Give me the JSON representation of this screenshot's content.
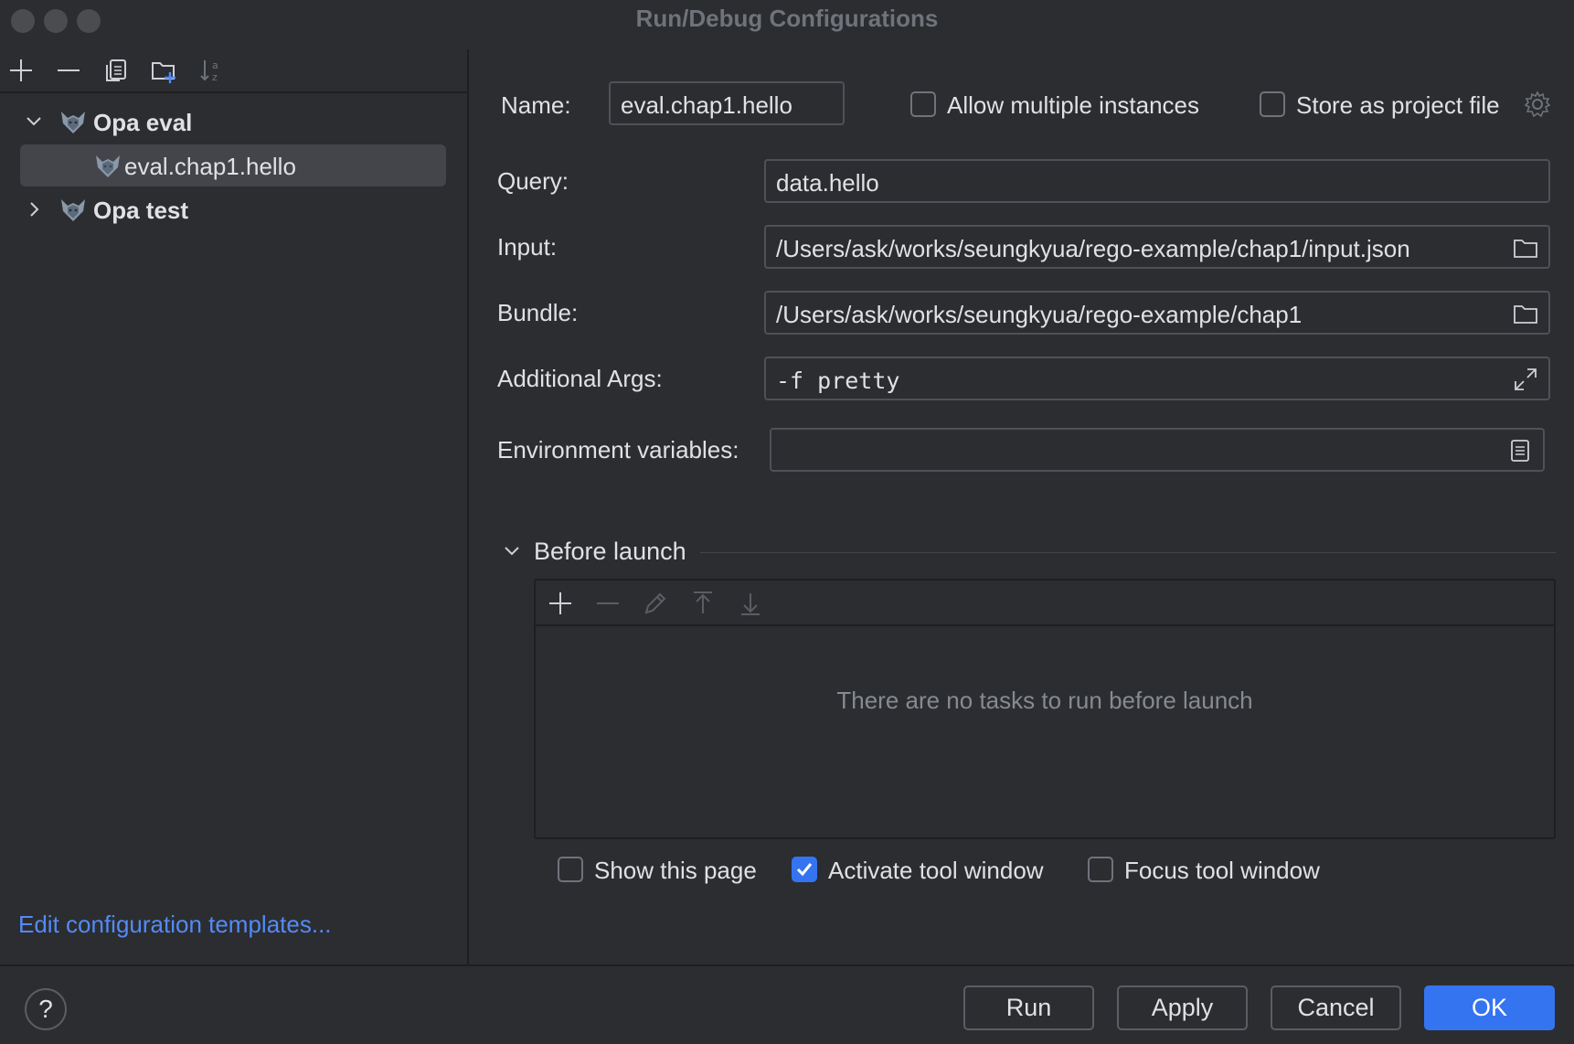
{
  "window": {
    "title": "Run/Debug Configurations"
  },
  "tree": {
    "groups": [
      {
        "label": "Opa eval",
        "expanded": true,
        "icon": "opa-icon",
        "children": [
          {
            "label": "eval.chap1.hello",
            "selected": true,
            "icon": "opa-icon"
          }
        ]
      },
      {
        "label": "Opa test",
        "expanded": false,
        "icon": "opa-icon",
        "children": []
      }
    ]
  },
  "left": {
    "templates_link": "Edit configuration templates..."
  },
  "config": {
    "name_label": "Name:",
    "name_value": "eval.chap1.hello",
    "allow_multiple_label": "Allow multiple instances",
    "allow_multiple_checked": false,
    "store_project_label": "Store as project file",
    "store_project_checked": false,
    "query_label": "Query:",
    "query_value": "data.hello",
    "input_label": "Input:",
    "input_value": "/Users/ask/works/seungkyua/rego-example/chap1/input.json",
    "bundle_label": "Bundle:",
    "bundle_value": "/Users/ask/works/seungkyua/rego-example/chap1",
    "args_label": "Additional Args:",
    "args_value": "-f pretty",
    "env_label": "Environment variables:",
    "env_value": ""
  },
  "before_launch": {
    "title": "Before launch",
    "empty_text": "There are no tasks to run before launch",
    "show_page_label": "Show this page",
    "show_page_checked": false,
    "activate_label": "Activate tool window",
    "activate_checked": true,
    "focus_label": "Focus tool window",
    "focus_checked": false
  },
  "buttons": {
    "help": "?",
    "run": "Run",
    "apply": "Apply",
    "cancel": "Cancel",
    "ok": "OK"
  },
  "colors": {
    "accent": "#3574f0",
    "link": "#548af7",
    "background": "#2b2d30",
    "selection": "#43454a"
  }
}
